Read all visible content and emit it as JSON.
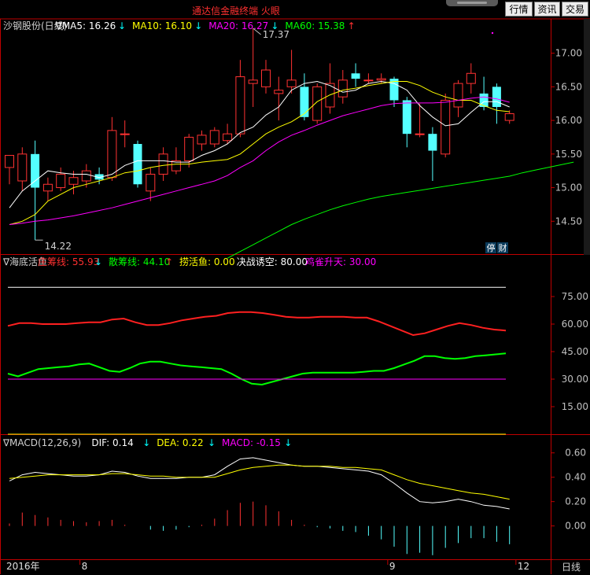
{
  "app": {
    "title": "通达信金融终端  火眼"
  },
  "toolbar": {
    "quote_label": "行情",
    "news_label": "资讯",
    "trade_label": "交易"
  },
  "period_label": "日线",
  "chart_data": [
    {
      "type": "candlestick",
      "header": {
        "stock": "沙钢股份(日线)",
        "items": [
          {
            "text": "∇MA5: 16.26",
            "arrow": "↓",
            "color": "#ffffff",
            "arrow_color": "#00ffff"
          },
          {
            "text": "MA10: 16.10",
            "arrow": "↓",
            "color": "#ffff00",
            "arrow_color": "#00ffff"
          },
          {
            "text": "MA20: 16.27",
            "arrow": "↓",
            "color": "#ff00ff",
            "arrow_color": "#00ffff"
          },
          {
            "text": "MA60: 15.38",
            "arrow": "↑",
            "color": "#00ff00",
            "arrow_color": "#ff3030"
          }
        ]
      },
      "ylim": [
        14.0,
        17.3
      ],
      "y_ticks": [
        14.5,
        15.0,
        15.5,
        16.0,
        16.5,
        17.0
      ],
      "y_tick_labels": [
        "14.50",
        "15.00",
        "15.50",
        "16.00",
        "16.50",
        "17.00"
      ],
      "annotations": {
        "high": "17.37",
        "low": "14.22"
      },
      "badges": [
        "停",
        "财"
      ],
      "candles": [
        {
          "o": 15.3,
          "h": 15.45,
          "l": 15.05,
          "c": 15.48
        },
        {
          "o": 15.1,
          "h": 15.6,
          "l": 14.95,
          "c": 15.5
        },
        {
          "o": 15.5,
          "h": 15.7,
          "l": 14.22,
          "c": 15.0
        },
        {
          "o": 14.95,
          "h": 15.15,
          "l": 14.8,
          "c": 15.05
        },
        {
          "o": 15.0,
          "h": 15.3,
          "l": 14.95,
          "c": 15.2
        },
        {
          "o": 15.05,
          "h": 15.25,
          "l": 14.9,
          "c": 15.15
        },
        {
          "o": 15.1,
          "h": 15.35,
          "l": 15.0,
          "c": 15.25
        },
        {
          "o": 15.2,
          "h": 15.3,
          "l": 15.05,
          "c": 15.12
        },
        {
          "o": 15.15,
          "h": 16.05,
          "l": 15.1,
          "c": 15.85
        },
        {
          "o": 15.8,
          "h": 16.0,
          "l": 15.6,
          "c": 15.8
        },
        {
          "o": 15.65,
          "h": 15.7,
          "l": 15.0,
          "c": 15.05
        },
        {
          "o": 14.95,
          "h": 15.3,
          "l": 14.8,
          "c": 15.2
        },
        {
          "o": 15.2,
          "h": 15.6,
          "l": 15.1,
          "c": 15.5
        },
        {
          "o": 15.25,
          "h": 15.6,
          "l": 15.2,
          "c": 15.4
        },
        {
          "o": 15.4,
          "h": 15.8,
          "l": 15.3,
          "c": 15.75
        },
        {
          "o": 15.65,
          "h": 15.85,
          "l": 15.55,
          "c": 15.78
        },
        {
          "o": 15.65,
          "h": 15.9,
          "l": 15.6,
          "c": 15.85
        },
        {
          "o": 15.7,
          "h": 15.95,
          "l": 15.65,
          "c": 15.8
        },
        {
          "o": 15.8,
          "h": 16.9,
          "l": 15.75,
          "c": 16.65
        },
        {
          "o": 16.55,
          "h": 17.37,
          "l": 16.2,
          "c": 16.6
        },
        {
          "o": 16.5,
          "h": 16.9,
          "l": 16.4,
          "c": 16.75
        },
        {
          "o": 16.4,
          "h": 16.65,
          "l": 16.0,
          "c": 16.45
        },
        {
          "o": 16.5,
          "h": 17.05,
          "l": 16.4,
          "c": 16.6
        },
        {
          "o": 16.5,
          "h": 16.7,
          "l": 16.0,
          "c": 16.05
        },
        {
          "o": 16.0,
          "h": 16.55,
          "l": 15.95,
          "c": 16.5
        },
        {
          "o": 16.2,
          "h": 16.85,
          "l": 16.1,
          "c": 16.55
        },
        {
          "o": 16.35,
          "h": 16.75,
          "l": 16.25,
          "c": 16.6
        },
        {
          "o": 16.7,
          "h": 16.85,
          "l": 16.5,
          "c": 16.62
        },
        {
          "o": 16.6,
          "h": 16.7,
          "l": 16.55,
          "c": 16.6
        },
        {
          "o": 16.6,
          "h": 16.7,
          "l": 16.55,
          "c": 16.62
        },
        {
          "o": 16.62,
          "h": 16.65,
          "l": 16.2,
          "c": 16.3
        },
        {
          "o": 16.3,
          "h": 16.35,
          "l": 15.6,
          "c": 15.8
        },
        {
          "o": 15.8,
          "h": 16.25,
          "l": 15.75,
          "c": 15.8
        },
        {
          "o": 15.8,
          "h": 15.9,
          "l": 15.1,
          "c": 15.55
        },
        {
          "o": 15.5,
          "h": 16.4,
          "l": 15.45,
          "c": 16.3
        },
        {
          "o": 16.2,
          "h": 16.6,
          "l": 16.05,
          "c": 16.55
        },
        {
          "o": 16.55,
          "h": 16.85,
          "l": 16.4,
          "c": 16.7
        },
        {
          "o": 16.4,
          "h": 16.65,
          "l": 16.15,
          "c": 16.2
        },
        {
          "o": 16.5,
          "h": 16.55,
          "l": 15.95,
          "c": 16.2
        },
        {
          "o": 16.0,
          "h": 16.15,
          "l": 15.95,
          "c": 16.1
        }
      ],
      "series": [
        {
          "name": "MA5",
          "color": "#ffffff",
          "values": [
            14.7,
            14.95,
            15.1,
            15.25,
            15.22,
            15.2,
            15.2,
            15.15,
            15.2,
            15.33,
            15.4,
            15.4,
            15.4,
            15.38,
            15.38,
            15.48,
            15.55,
            15.65,
            15.82,
            15.9,
            16.08,
            16.2,
            16.45,
            16.55,
            16.58,
            16.52,
            16.42,
            16.45,
            16.55,
            16.58,
            16.55,
            16.45,
            16.22,
            16.05,
            15.92,
            15.95,
            16.12,
            16.28,
            16.28,
            16.2
          ]
        },
        {
          "name": "MA10",
          "color": "#ffff00",
          "values": [
            14.45,
            14.5,
            14.6,
            14.8,
            14.9,
            15.0,
            15.05,
            15.1,
            15.15,
            15.22,
            15.25,
            15.3,
            15.33,
            15.35,
            15.35,
            15.38,
            15.4,
            15.42,
            15.5,
            15.65,
            15.8,
            15.9,
            15.98,
            16.1,
            16.28,
            16.38,
            16.45,
            16.48,
            16.52,
            16.55,
            16.58,
            16.58,
            16.52,
            16.42,
            16.35,
            16.3,
            16.3,
            16.22,
            16.15,
            16.13
          ]
        },
        {
          "name": "MA20",
          "color": "#ff00ff",
          "values": [
            14.45,
            14.47,
            14.5,
            14.52,
            14.55,
            14.58,
            14.62,
            14.66,
            14.7,
            14.75,
            14.8,
            14.85,
            14.9,
            14.95,
            15.0,
            15.05,
            15.1,
            15.18,
            15.3,
            15.4,
            15.55,
            15.68,
            15.78,
            15.85,
            15.93,
            16.0,
            16.07,
            16.12,
            16.17,
            16.22,
            16.25,
            16.26,
            16.26,
            16.26,
            16.27,
            16.3,
            16.33,
            16.35,
            16.32,
            16.27
          ]
        },
        {
          "name": "MA60",
          "color": "#00ff00",
          "start": 17,
          "values": [
            13.95,
            14.05,
            14.15,
            14.25,
            14.35,
            14.45,
            14.53,
            14.6,
            14.67,
            14.73,
            14.78,
            14.83,
            14.87,
            14.9,
            14.93,
            14.96,
            14.99,
            15.02,
            15.05,
            15.08,
            15.11,
            15.14,
            15.17,
            15.22,
            15.26,
            15.3,
            15.34,
            15.38
          ]
        }
      ]
    },
    {
      "type": "line",
      "header": {
        "title": "∇海底活鱼",
        "items": [
          {
            "text": "庄筹线: 55.93",
            "arrow": "↓",
            "color": "#ff3030",
            "arrow_color": "#00ffff"
          },
          {
            "text": "散筹线: 44.10",
            "arrow": "↑",
            "color": "#00ff00",
            "arrow_color": "#ff3030"
          },
          {
            "text": "捞活鱼: 0.00",
            "arrow": "",
            "color": "#ffff00",
            "arrow_color": ""
          },
          {
            "text": "决战诱空: 80.00",
            "arrow": "",
            "color": "#ffffff",
            "arrow_color": ""
          },
          {
            "text": "鸡雀升天: 30.00",
            "arrow": "",
            "color": "#ff00ff",
            "arrow_color": ""
          }
        ]
      },
      "ylim": [
        0,
        90
      ],
      "y_ticks": [
        15,
        30,
        45,
        60,
        75
      ],
      "y_tick_labels": [
        "15.00",
        "30.00",
        "45.00",
        "60.00",
        "75.00"
      ],
      "series": [
        {
          "name": "庄筹线",
          "color": "#ff2020",
          "values": [
            59,
            60.5,
            60.5,
            60,
            60,
            60,
            60.5,
            61,
            61,
            62.5,
            63,
            61,
            59.5,
            59.5,
            60.5,
            62,
            63,
            64,
            64.5,
            66,
            66.5,
            66.5,
            66,
            65,
            64,
            63.5,
            63.5,
            64,
            64,
            64,
            63.5,
            63.5,
            61.5,
            59,
            56.5,
            54,
            55,
            57,
            59,
            60.5,
            59.5,
            58,
            57,
            56.5
          ]
        },
        {
          "name": "散筹线",
          "color": "#00ff00",
          "values": [
            33,
            31.5,
            33.5,
            35.5,
            36,
            36.5,
            37,
            38,
            38.5,
            36.5,
            34.5,
            34,
            36,
            38.5,
            39.5,
            39.5,
            38.5,
            37.5,
            37,
            36.5,
            36,
            35.5,
            33,
            30,
            27.5,
            27,
            28.5,
            30,
            31.5,
            33,
            33.5,
            33.5,
            33.5,
            33.5,
            33.5,
            34,
            34.5,
            34.5,
            36,
            38,
            40,
            42.5,
            42.5,
            41.5,
            41,
            41.5,
            42.5,
            43,
            43.5,
            44
          ]
        },
        {
          "name": "决战诱空",
          "color": "#ffffff",
          "values": [
            80,
            80
          ]
        },
        {
          "name": "鸡雀升天",
          "color": "#ff00ff",
          "values": [
            30,
            30
          ]
        },
        {
          "name": "捞活鱼",
          "color": "#ffff00",
          "values": [
            0,
            0
          ]
        }
      ]
    },
    {
      "type": "macd",
      "header": {
        "title": "∇MACD(12,26,9)",
        "items": [
          {
            "text": "DIF: 0.14",
            "arrow": "↓",
            "color": "#ffffff",
            "arrow_color": "#00ffff"
          },
          {
            "text": "DEA: 0.22",
            "arrow": "↓",
            "color": "#ffff00",
            "arrow_color": "#00ffff"
          },
          {
            "text": "MACD: -0.15",
            "arrow": "↓",
            "color": "#ff00ff",
            "arrow_color": "#00ffff"
          }
        ]
      },
      "ylim": [
        -0.28,
        0.65
      ],
      "y_ticks": [
        0.0,
        0.2,
        0.4,
        0.6
      ],
      "y_tick_labels": [
        "0.00",
        "0.20",
        "0.40",
        "0.60"
      ],
      "x_labels": [
        {
          "label": "2016年",
          "index": 0
        },
        {
          "label": "8",
          "index": 5.5
        },
        {
          "label": "9",
          "index": 29.5
        },
        {
          "label": "12",
          "index": 39.5
        }
      ],
      "series": [
        {
          "name": "DIF",
          "color": "#ffffff",
          "values": [
            0.37,
            0.42,
            0.44,
            0.43,
            0.42,
            0.41,
            0.41,
            0.42,
            0.45,
            0.44,
            0.41,
            0.39,
            0.39,
            0.39,
            0.4,
            0.4,
            0.42,
            0.49,
            0.55,
            0.56,
            0.54,
            0.52,
            0.5,
            0.49,
            0.49,
            0.48,
            0.47,
            0.46,
            0.45,
            0.42,
            0.35,
            0.27,
            0.2,
            0.19,
            0.2,
            0.22,
            0.2,
            0.17,
            0.16,
            0.14
          ]
        },
        {
          "name": "DEA",
          "color": "#ffff00",
          "values": [
            0.39,
            0.4,
            0.41,
            0.42,
            0.42,
            0.42,
            0.42,
            0.42,
            0.43,
            0.43,
            0.42,
            0.41,
            0.41,
            0.4,
            0.4,
            0.4,
            0.4,
            0.43,
            0.46,
            0.48,
            0.49,
            0.5,
            0.5,
            0.49,
            0.49,
            0.49,
            0.48,
            0.48,
            0.47,
            0.46,
            0.42,
            0.38,
            0.35,
            0.33,
            0.31,
            0.29,
            0.27,
            0.26,
            0.24,
            0.22
          ]
        },
        {
          "name": "MACD",
          "color": "#ff00ff",
          "values": [
            0.02,
            0.11,
            0.09,
            0.07,
            0.05,
            0.04,
            0.03,
            0.04,
            0.05,
            0.01,
            0.0,
            -0.03,
            -0.04,
            -0.03,
            -0.01,
            0.01,
            0.06,
            0.13,
            0.19,
            0.2,
            0.17,
            0.12,
            0.05,
            0.01,
            -0.01,
            -0.02,
            -0.04,
            -0.05,
            -0.08,
            -0.11,
            -0.17,
            -0.23,
            -0.22,
            -0.24,
            -0.18,
            -0.14,
            -0.1,
            -0.1,
            -0.13,
            -0.15
          ]
        }
      ]
    }
  ]
}
